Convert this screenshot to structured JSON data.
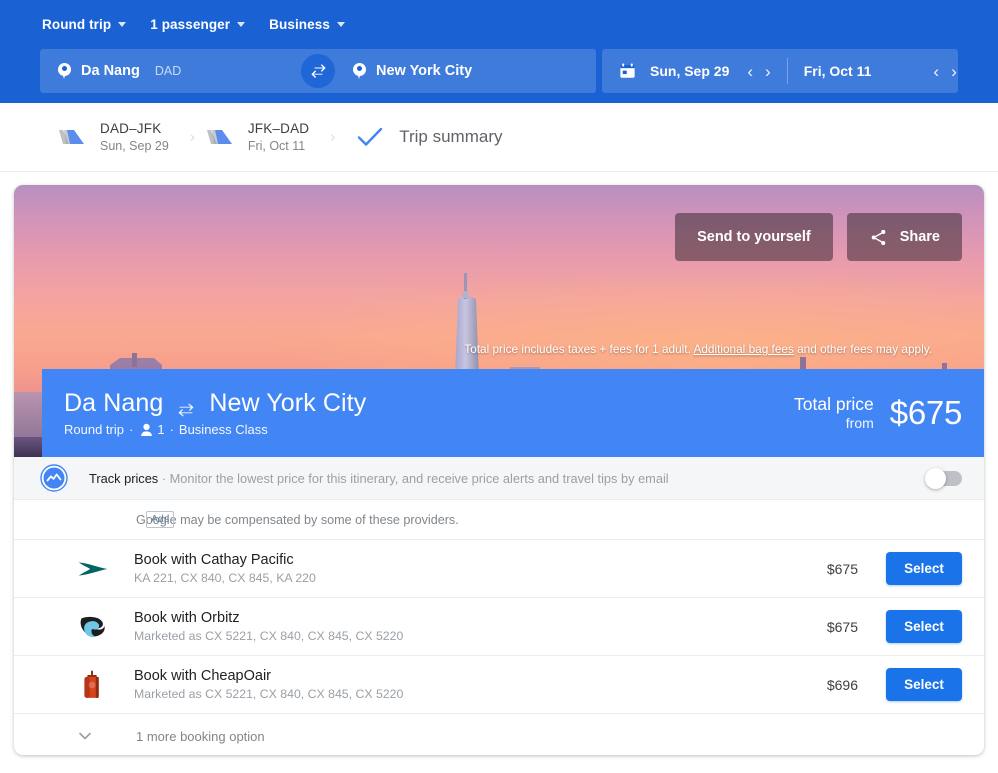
{
  "header": {
    "options": [
      {
        "label": "Round trip",
        "icon": "chevron-down-icon"
      },
      {
        "label": "1 passenger",
        "icon": "chevron-down-icon"
      },
      {
        "label": "Business",
        "icon": "chevron-down-icon"
      }
    ],
    "origin": {
      "city": "Da Nang",
      "code": "DAD",
      "icon": "location-pin-icon"
    },
    "destination": {
      "city": "New York City",
      "code": "",
      "icon": "location-pin-icon"
    },
    "swap_icon": "swap-arrows-icon",
    "calendar_icon": "calendar-icon",
    "depart_date": "Sun, Sep 29",
    "return_date": "Fri, Oct 11",
    "prev_icon": "chevron-left-icon",
    "next_icon": "chevron-right-icon",
    "bg_color": "#1a62d4"
  },
  "breadcrumb": {
    "tabs": [
      {
        "route": "DAD–JFK",
        "date": "Sun, Sep 29",
        "icon": "airplane-icon"
      },
      {
        "route": "JFK–DAD",
        "date": "Fri, Oct 11",
        "icon": "airplane-icon"
      }
    ],
    "summary_label": "Trip summary",
    "summary_icon": "check-icon"
  },
  "hero": {
    "send_label": "Send to yourself",
    "share_label": "Share",
    "share_icon": "share-icon",
    "disclaimer_pre": "Total price includes taxes + fees for 1 adult. ",
    "disclaimer_link": "Additional bag fees",
    "disclaimer_post": " and other fees may apply."
  },
  "summary_band": {
    "origin": "Da Nang",
    "destination": "New York City",
    "swap_icon": "swap-arrows-icon",
    "trip_type": "Round trip",
    "passenger_icon": "person-icon",
    "passenger_count": "1",
    "cabin": "Business Class",
    "total_label": "Total price",
    "from_label": "from",
    "price": "$675",
    "bg_color": "#4285f4"
  },
  "track_prices": {
    "icon": "trending-line-icon",
    "title": "Track prices",
    "separator": " · ",
    "description": "Monitor the lowest price for this itinerary, and receive price alerts and travel tips by email",
    "toggle_state": "off"
  },
  "ads_notice": {
    "badge": "Ads",
    "text": "Google may be compensated by some of these providers."
  },
  "booking_options": [
    {
      "logo": "cathay-pacific-logo",
      "title": "Book with Cathay Pacific",
      "subtitle": "KA 221, CX 840, CX 845, KA 220",
      "price": "$675",
      "button_label": "Select"
    },
    {
      "logo": "orbitz-logo",
      "title": "Book with Orbitz",
      "subtitle": "Marketed as CX 5221, CX 840, CX 845, CX 5220",
      "price": "$675",
      "button_label": "Select"
    },
    {
      "logo": "cheapoair-logo",
      "title": "Book with CheapOair",
      "subtitle": "Marketed as CX 5221, CX 840, CX 845, CX 5220",
      "price": "$696",
      "button_label": "Select"
    }
  ],
  "more_options": {
    "icon": "chevron-down-icon",
    "label": "1 more booking option"
  }
}
